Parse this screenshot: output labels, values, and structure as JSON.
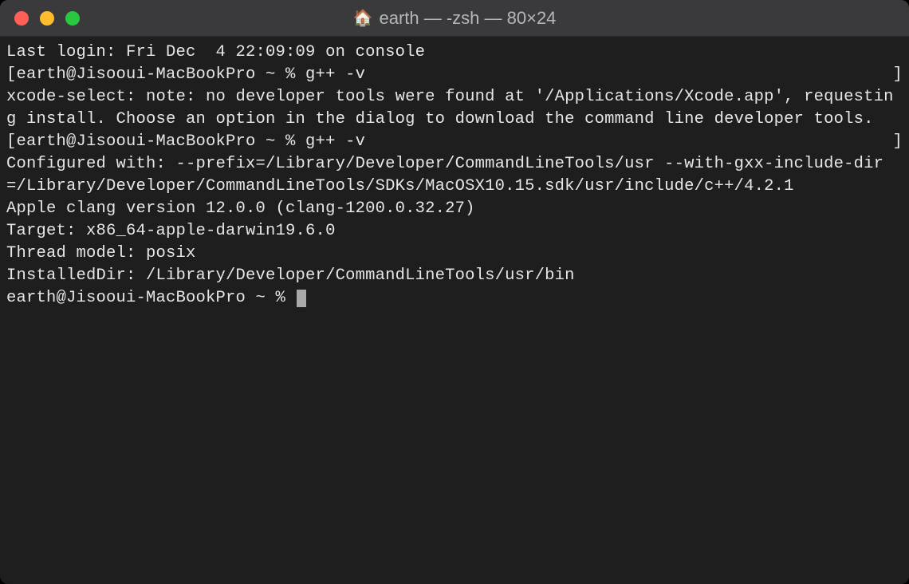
{
  "titlebar": {
    "title": "earth — -zsh — 80×24",
    "home_icon": "🏠"
  },
  "terminal": {
    "line1": "Last login: Fri Dec  4 22:09:09 on console",
    "prompt1_left": "[earth@Jisooui-MacBookPro ~ % g++ -v",
    "prompt1_right": "]",
    "line3": "xcode-select: note: no developer tools were found at '/Applications/Xcode.app', requesting install. Choose an option in the dialog to download the command line developer tools.",
    "prompt2_left": "[earth@Jisooui-MacBookPro ~ % g++ -v",
    "prompt2_right": "]",
    "line5": "Configured with: --prefix=/Library/Developer/CommandLineTools/usr --with-gxx-include-dir=/Library/Developer/CommandLineTools/SDKs/MacOSX10.15.sdk/usr/include/c++/4.2.1",
    "line6": "Apple clang version 12.0.0 (clang-1200.0.32.27)",
    "line7": "Target: x86_64-apple-darwin19.6.0",
    "line8": "Thread model: posix",
    "line9": "InstalledDir: /Library/Developer/CommandLineTools/usr/bin",
    "prompt3": "earth@Jisooui-MacBookPro ~ % "
  }
}
